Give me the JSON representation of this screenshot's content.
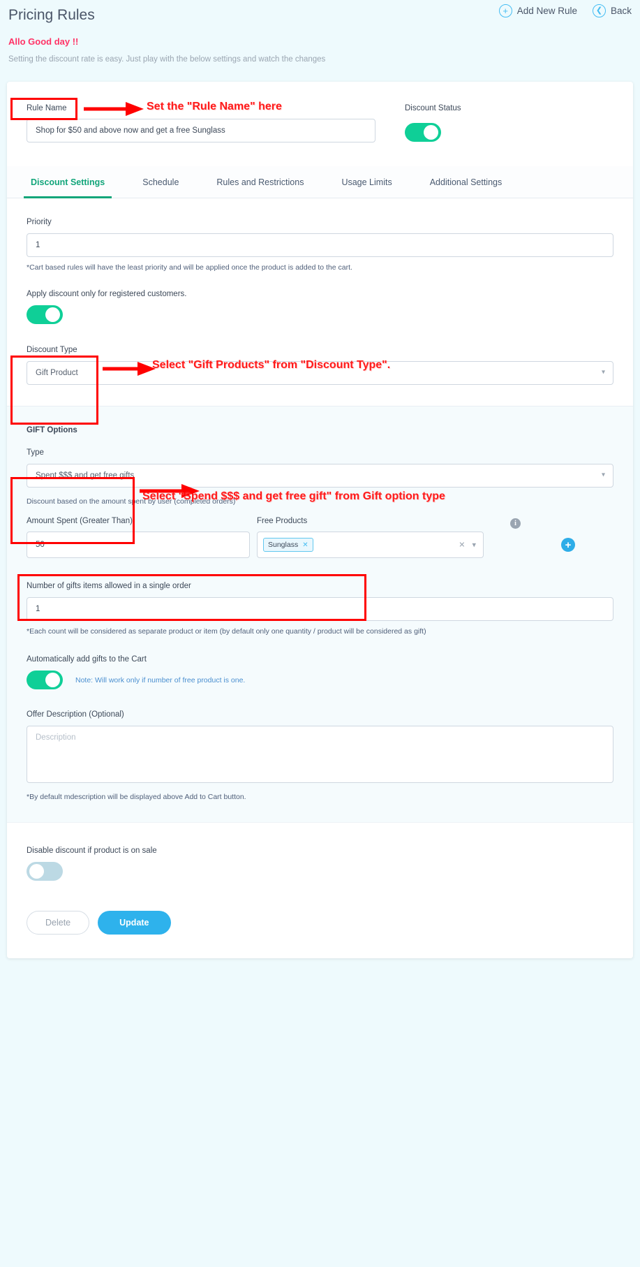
{
  "header": {
    "title": "Pricing Rules",
    "add_new_rule": "Add New Rule",
    "back": "Back",
    "add_icon": "plus-circle-icon",
    "back_icon": "chevron-left-circle-icon"
  },
  "intro": {
    "greeting": "Allo Good day !!",
    "subtitle": "Setting the discount rate is easy. Just play with the below settings and watch the changes"
  },
  "rule": {
    "name_label": "Rule Name",
    "name_value": "Shop for $50 and above now and get a free Sunglass",
    "name_placeholder": "Rule Name",
    "status_label": "Discount Status",
    "status_on": true
  },
  "tabs": [
    {
      "label": "Discount Settings",
      "active": true
    },
    {
      "label": "Schedule",
      "active": false
    },
    {
      "label": "Rules and Restrictions",
      "active": false
    },
    {
      "label": "Usage Limits",
      "active": false
    },
    {
      "label": "Additional Settings",
      "active": false
    }
  ],
  "discount_settings": {
    "priority_label": "Priority",
    "priority_value": "1",
    "priority_hint": "*Cart based rules will have the least priority and will be applied once the product is added to the cart.",
    "registered_label": "Apply discount only for registered customers.",
    "registered_on": true,
    "discount_type_label": "Discount Type",
    "discount_type_value": "Gift Product",
    "discount_type_chevron": "chevron-down-icon"
  },
  "gift_options": {
    "section_title": "GIFT Options",
    "type_label": "Type",
    "type_value": "Spent $$$ and get free gifts",
    "type_chevron": "chevron-down-icon",
    "based_on_note": "Discount based on the amount spent by user (completed orders)",
    "amount_header": "Amount Spent (Greater Than)",
    "amount_value": "50",
    "free_products_header": "Free Products",
    "free_products_chips": [
      {
        "label": "Sunglass",
        "remove_icon": "chip-remove-icon"
      }
    ],
    "clear_icon": "clear-x-icon",
    "dropdown_icon": "chevron-down-icon",
    "info_icon": "info-icon",
    "add_icon": "plus-circle-icon",
    "count_label": "Number of gifts items allowed in a single order",
    "count_value": "1",
    "count_hint": "*Each count will be considered as separate product or item (by default only one quantity / product will be considered as gift)",
    "auto_add_label": "Automatically add gifts to the Cart",
    "auto_add_on": true,
    "auto_add_note": "Note: Will work only if number of free product is one.",
    "offer_desc_label": "Offer Description (Optional)",
    "offer_desc_value": "",
    "offer_desc_placeholder": "Description",
    "offer_desc_hint": "*By default mdescription will be displayed above Add to Cart button."
  },
  "footer": {
    "disable_sale_label": "Disable discount if product is on sale",
    "disable_sale_on": false,
    "delete_label": "Delete",
    "update_label": "Update"
  },
  "annotations": [
    {
      "text": "Set the \"Rule Name\" here"
    },
    {
      "text": "Select \"Gift Products\" from \"Discount Type\"."
    },
    {
      "text": "Select \"Spend $$$ and get free gift\" from Gift option type"
    }
  ],
  "colors": {
    "accent_blue": "#2eb2ec",
    "toggle_green": "#0fcf97",
    "tab_active": "#12a57a",
    "greeting_pink": "#ff3366",
    "annotation_red": "#ff0000",
    "page_bg": "#eefafd"
  }
}
